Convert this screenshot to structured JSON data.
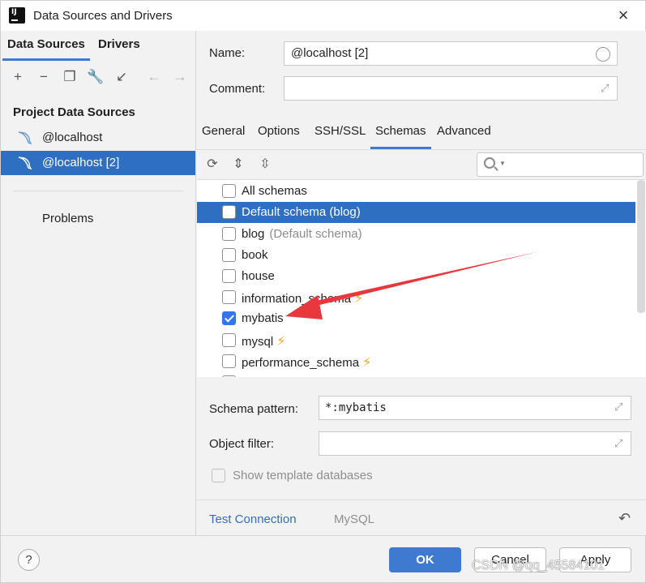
{
  "window": {
    "title": "Data Sources and Drivers"
  },
  "left": {
    "tabs": [
      "Data Sources",
      "Drivers"
    ],
    "section": "Project Data Sources",
    "items": [
      {
        "label": "@localhost",
        "selected": false
      },
      {
        "label": "@localhost [2]",
        "selected": true
      }
    ],
    "problems": "Problems"
  },
  "right": {
    "name_label": "Name:",
    "name_value": "@localhost [2]",
    "comment_label": "Comment:",
    "comment_value": "",
    "tabs": [
      "General",
      "Options",
      "SSH/SSL",
      "Schemas",
      "Advanced"
    ],
    "active_tab": "Schemas",
    "schemas": [
      {
        "label": "All schemas",
        "checked": false,
        "hint": "",
        "bolt": false,
        "selected": false
      },
      {
        "label": "Default schema (blog)",
        "checked": false,
        "hint": "",
        "bolt": false,
        "selected": true
      },
      {
        "label": "blog",
        "checked": false,
        "hint": "(Default schema)",
        "bolt": false,
        "selected": false
      },
      {
        "label": "book",
        "checked": false,
        "hint": "",
        "bolt": false,
        "selected": false
      },
      {
        "label": "house",
        "checked": false,
        "hint": "",
        "bolt": false,
        "selected": false
      },
      {
        "label": "information_schema",
        "checked": false,
        "hint": "",
        "bolt": true,
        "selected": false
      },
      {
        "label": "mybatis",
        "checked": true,
        "hint": "",
        "bolt": false,
        "selected": false
      },
      {
        "label": "mysql",
        "checked": false,
        "hint": "",
        "bolt": true,
        "selected": false
      },
      {
        "label": "performance_schema",
        "checked": false,
        "hint": "",
        "bolt": true,
        "selected": false
      }
    ],
    "schema_pattern_label": "Schema pattern:",
    "schema_pattern_value": "*:mybatis",
    "object_filter_label": "Object filter:",
    "object_filter_value": "",
    "show_template_label": "Show template databases",
    "test_connection": "Test Connection",
    "driver": "MySQL"
  },
  "footer": {
    "help": "?",
    "ok": "OK",
    "cancel": "Cancel",
    "apply": "Apply"
  },
  "watermark": "CSDN @qq_45584101",
  "colors": {
    "accent": "#3f7ad1",
    "selection": "#2f6fc2",
    "bolt": "#f2a51a",
    "arrow": "#e8383d"
  }
}
